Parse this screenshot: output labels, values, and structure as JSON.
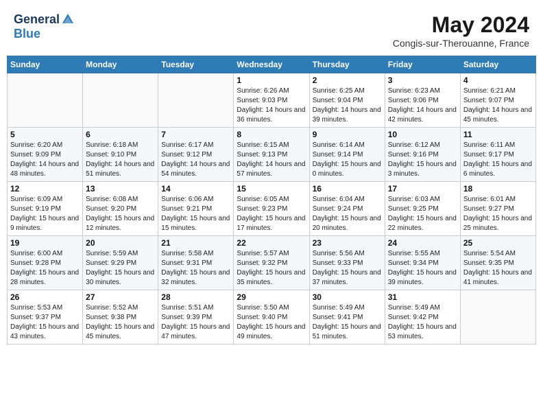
{
  "header": {
    "logo_general": "General",
    "logo_blue": "Blue",
    "month_title": "May 2024",
    "subtitle": "Congis-sur-Therouanne, France"
  },
  "weekdays": [
    "Sunday",
    "Monday",
    "Tuesday",
    "Wednesday",
    "Thursday",
    "Friday",
    "Saturday"
  ],
  "weeks": [
    [
      {
        "day": "",
        "sunrise": "",
        "sunset": "",
        "daylight": ""
      },
      {
        "day": "",
        "sunrise": "",
        "sunset": "",
        "daylight": ""
      },
      {
        "day": "",
        "sunrise": "",
        "sunset": "",
        "daylight": ""
      },
      {
        "day": "1",
        "sunrise": "Sunrise: 6:26 AM",
        "sunset": "Sunset: 9:03 PM",
        "daylight": "Daylight: 14 hours and 36 minutes."
      },
      {
        "day": "2",
        "sunrise": "Sunrise: 6:25 AM",
        "sunset": "Sunset: 9:04 PM",
        "daylight": "Daylight: 14 hours and 39 minutes."
      },
      {
        "day": "3",
        "sunrise": "Sunrise: 6:23 AM",
        "sunset": "Sunset: 9:06 PM",
        "daylight": "Daylight: 14 hours and 42 minutes."
      },
      {
        "day": "4",
        "sunrise": "Sunrise: 6:21 AM",
        "sunset": "Sunset: 9:07 PM",
        "daylight": "Daylight: 14 hours and 45 minutes."
      }
    ],
    [
      {
        "day": "5",
        "sunrise": "Sunrise: 6:20 AM",
        "sunset": "Sunset: 9:09 PM",
        "daylight": "Daylight: 14 hours and 48 minutes."
      },
      {
        "day": "6",
        "sunrise": "Sunrise: 6:18 AM",
        "sunset": "Sunset: 9:10 PM",
        "daylight": "Daylight: 14 hours and 51 minutes."
      },
      {
        "day": "7",
        "sunrise": "Sunrise: 6:17 AM",
        "sunset": "Sunset: 9:12 PM",
        "daylight": "Daylight: 14 hours and 54 minutes."
      },
      {
        "day": "8",
        "sunrise": "Sunrise: 6:15 AM",
        "sunset": "Sunset: 9:13 PM",
        "daylight": "Daylight: 14 hours and 57 minutes."
      },
      {
        "day": "9",
        "sunrise": "Sunrise: 6:14 AM",
        "sunset": "Sunset: 9:14 PM",
        "daylight": "Daylight: 15 hours and 0 minutes."
      },
      {
        "day": "10",
        "sunrise": "Sunrise: 6:12 AM",
        "sunset": "Sunset: 9:16 PM",
        "daylight": "Daylight: 15 hours and 3 minutes."
      },
      {
        "day": "11",
        "sunrise": "Sunrise: 6:11 AM",
        "sunset": "Sunset: 9:17 PM",
        "daylight": "Daylight: 15 hours and 6 minutes."
      }
    ],
    [
      {
        "day": "12",
        "sunrise": "Sunrise: 6:09 AM",
        "sunset": "Sunset: 9:19 PM",
        "daylight": "Daylight: 15 hours and 9 minutes."
      },
      {
        "day": "13",
        "sunrise": "Sunrise: 6:08 AM",
        "sunset": "Sunset: 9:20 PM",
        "daylight": "Daylight: 15 hours and 12 minutes."
      },
      {
        "day": "14",
        "sunrise": "Sunrise: 6:06 AM",
        "sunset": "Sunset: 9:21 PM",
        "daylight": "Daylight: 15 hours and 15 minutes."
      },
      {
        "day": "15",
        "sunrise": "Sunrise: 6:05 AM",
        "sunset": "Sunset: 9:23 PM",
        "daylight": "Daylight: 15 hours and 17 minutes."
      },
      {
        "day": "16",
        "sunrise": "Sunrise: 6:04 AM",
        "sunset": "Sunset: 9:24 PM",
        "daylight": "Daylight: 15 hours and 20 minutes."
      },
      {
        "day": "17",
        "sunrise": "Sunrise: 6:03 AM",
        "sunset": "Sunset: 9:25 PM",
        "daylight": "Daylight: 15 hours and 22 minutes."
      },
      {
        "day": "18",
        "sunrise": "Sunrise: 6:01 AM",
        "sunset": "Sunset: 9:27 PM",
        "daylight": "Daylight: 15 hours and 25 minutes."
      }
    ],
    [
      {
        "day": "19",
        "sunrise": "Sunrise: 6:00 AM",
        "sunset": "Sunset: 9:28 PM",
        "daylight": "Daylight: 15 hours and 28 minutes."
      },
      {
        "day": "20",
        "sunrise": "Sunrise: 5:59 AM",
        "sunset": "Sunset: 9:29 PM",
        "daylight": "Daylight: 15 hours and 30 minutes."
      },
      {
        "day": "21",
        "sunrise": "Sunrise: 5:58 AM",
        "sunset": "Sunset: 9:31 PM",
        "daylight": "Daylight: 15 hours and 32 minutes."
      },
      {
        "day": "22",
        "sunrise": "Sunrise: 5:57 AM",
        "sunset": "Sunset: 9:32 PM",
        "daylight": "Daylight: 15 hours and 35 minutes."
      },
      {
        "day": "23",
        "sunrise": "Sunrise: 5:56 AM",
        "sunset": "Sunset: 9:33 PM",
        "daylight": "Daylight: 15 hours and 37 minutes."
      },
      {
        "day": "24",
        "sunrise": "Sunrise: 5:55 AM",
        "sunset": "Sunset: 9:34 PM",
        "daylight": "Daylight: 15 hours and 39 minutes."
      },
      {
        "day": "25",
        "sunrise": "Sunrise: 5:54 AM",
        "sunset": "Sunset: 9:35 PM",
        "daylight": "Daylight: 15 hours and 41 minutes."
      }
    ],
    [
      {
        "day": "26",
        "sunrise": "Sunrise: 5:53 AM",
        "sunset": "Sunset: 9:37 PM",
        "daylight": "Daylight: 15 hours and 43 minutes."
      },
      {
        "day": "27",
        "sunrise": "Sunrise: 5:52 AM",
        "sunset": "Sunset: 9:38 PM",
        "daylight": "Daylight: 15 hours and 45 minutes."
      },
      {
        "day": "28",
        "sunrise": "Sunrise: 5:51 AM",
        "sunset": "Sunset: 9:39 PM",
        "daylight": "Daylight: 15 hours and 47 minutes."
      },
      {
        "day": "29",
        "sunrise": "Sunrise: 5:50 AM",
        "sunset": "Sunset: 9:40 PM",
        "daylight": "Daylight: 15 hours and 49 minutes."
      },
      {
        "day": "30",
        "sunrise": "Sunrise: 5:49 AM",
        "sunset": "Sunset: 9:41 PM",
        "daylight": "Daylight: 15 hours and 51 minutes."
      },
      {
        "day": "31",
        "sunrise": "Sunrise: 5:49 AM",
        "sunset": "Sunset: 9:42 PM",
        "daylight": "Daylight: 15 hours and 53 minutes."
      },
      {
        "day": "",
        "sunrise": "",
        "sunset": "",
        "daylight": ""
      }
    ]
  ]
}
